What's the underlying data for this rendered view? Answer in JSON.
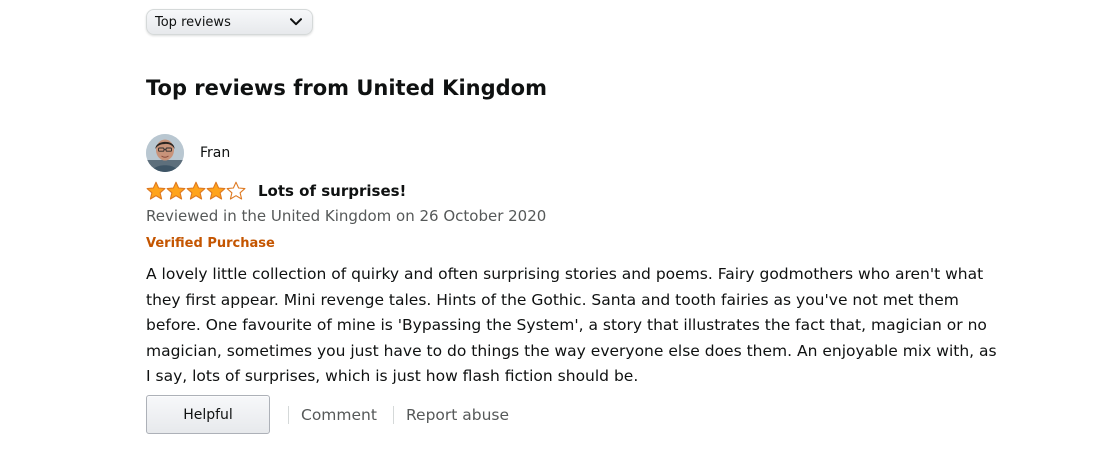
{
  "sort": {
    "selected": "Top reviews",
    "icon": "chevron-down-icon"
  },
  "section": {
    "title": "Top reviews from United Kingdom"
  },
  "review": {
    "reviewer_name": "Fran",
    "avatar_icon": "user-avatar",
    "rating": 4,
    "max_rating": 5,
    "title": "Lots of surprises!",
    "date_line": "Reviewed in the United Kingdom on 26 October 2020",
    "verified_label": "Verified Purchase",
    "body": "A lovely little collection of quirky and often surprising stories and poems. Fairy godmothers who aren't what they first appear. Mini revenge tales. Hints of the Gothic. Santa and tooth fairies as you've not met them before. One favourite of mine is 'Bypassing the System', a story that illustrates the fact that, magician or no magician, sometimes you just have to do things the way everyone else does them. An enjoyable mix with, as I say, lots of surprises, which is just how flash fiction should be."
  },
  "actions": {
    "helpful_label": "Helpful",
    "comment_label": "Comment",
    "report_label": "Report abuse"
  },
  "colors": {
    "star_fill": "#ffa41c",
    "star_outline": "#de7921",
    "verified": "#c45500",
    "secondary_text": "#565959"
  }
}
